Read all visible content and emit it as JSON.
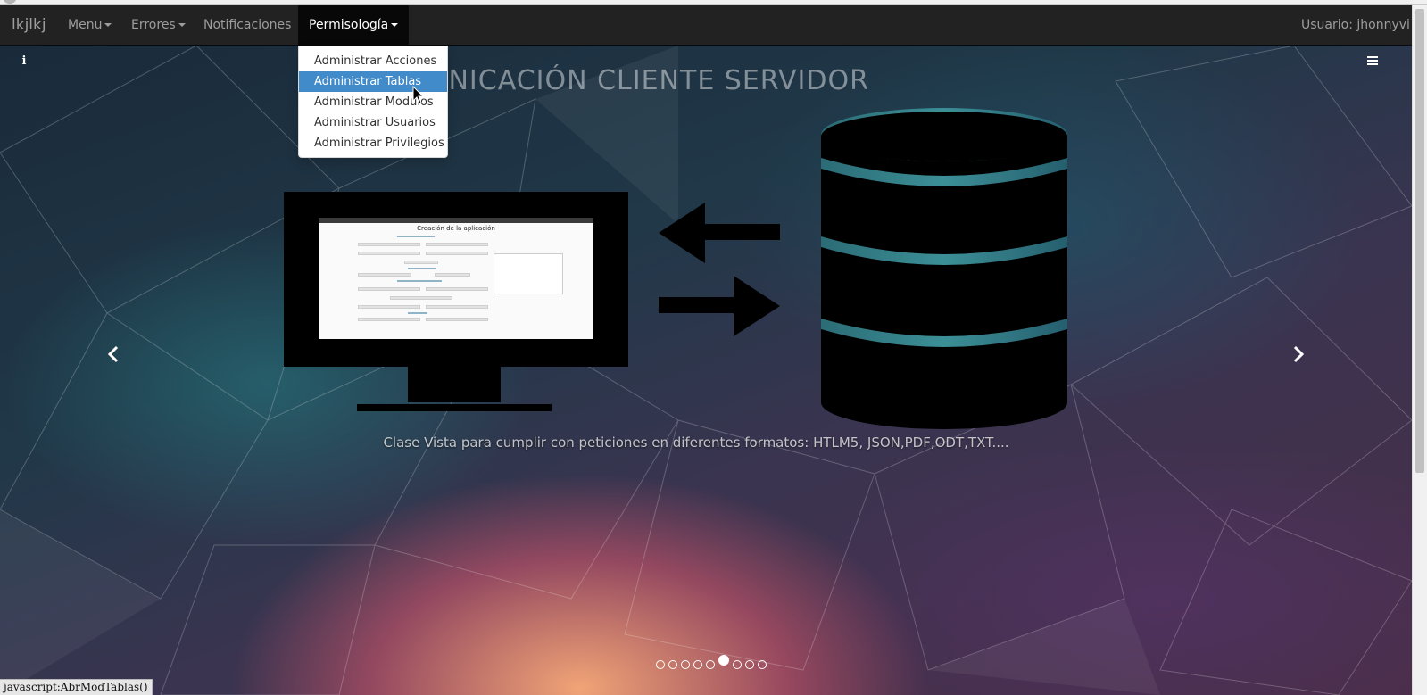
{
  "navbar": {
    "brand": "lkjlkj",
    "menus": [
      {
        "label": "Menu",
        "has_caret": true
      },
      {
        "label": "Errores",
        "has_caret": true
      },
      {
        "label": "Notificaciones",
        "has_caret": false
      },
      {
        "label": "Permisología",
        "has_caret": true,
        "active": true
      }
    ],
    "user": "Usuario: jhonnyvi"
  },
  "dropdown": {
    "items": [
      {
        "label": "Administrar Acciones"
      },
      {
        "label": "Administrar Tablas",
        "hovered": true
      },
      {
        "label": "Administrar Modulos"
      },
      {
        "label": "Administrar Usuarios"
      },
      {
        "label": "Administrar Privilegios"
      }
    ]
  },
  "carousel": {
    "title": "COMUNICACIÓN CLIENTE SERVIDOR",
    "caption": "Clase Vista para cumplir con peticiones en diferentes formatos: HTLM5, JSON,PDF,ODT,TXT....",
    "prev_icon": "chevron-left-icon",
    "next_icon": "chevron-right-icon",
    "indicator_count": 9,
    "active_indicator": 6,
    "screenshot_title": "Creación de la aplicación"
  },
  "toolbar_icons": {
    "left": "info-icon",
    "right": "hamburger-menu-icon"
  },
  "status_bar": {
    "text": "javascript:AbrModTablas()"
  },
  "colors": {
    "navbar_bg": "#222222",
    "navbar_text": "#9d9d9d",
    "navbar_active_bg": "#080808",
    "dropdown_hover": "#428bca"
  }
}
